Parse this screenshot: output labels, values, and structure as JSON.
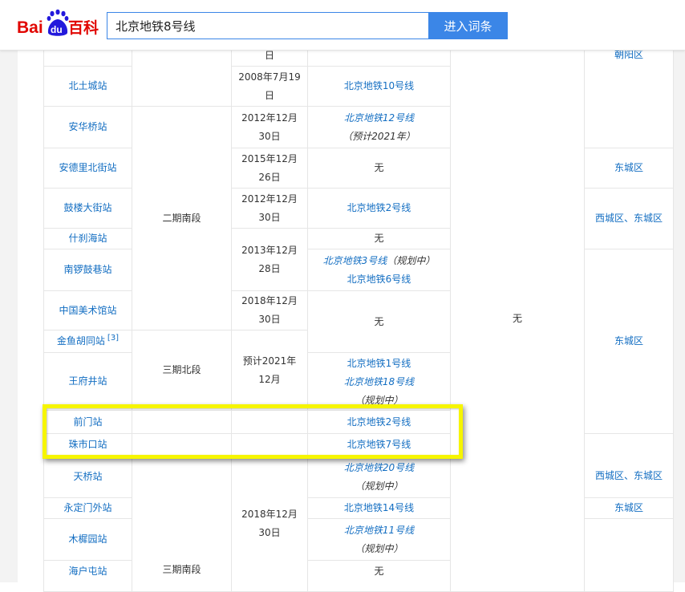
{
  "header": {
    "logo": {
      "bai": "Bai",
      "du": "du",
      "baike": "百科"
    },
    "search_value": "北京地铁8号线",
    "button_label": "进入词条"
  },
  "table": {
    "rows": [
      {
        "station": "",
        "date": "日",
        "transfer": "",
        "district": "朝阳区"
      },
      {
        "station": "北土城站",
        "date": "2008年7月19日",
        "transfer": "北京地铁10号线"
      },
      {
        "station": "安华桥站",
        "date": "2012年12月30日",
        "transfer": "北京地铁12号线",
        "transfer_note": "（预计2021年）"
      },
      {
        "station": "安德里北街站",
        "date": "2015年12月26日",
        "transfer": "无",
        "district": "东城区"
      },
      {
        "station": "鼓楼大街站",
        "date": "2012年12月30日",
        "transfer": "北京地铁2号线",
        "district": "西城区、东城区"
      },
      {
        "station": "什刹海站",
        "date": "2013年12月28日",
        "transfer": "无"
      },
      {
        "station": "南锣鼓巷站",
        "transfer": "北京地铁3号线",
        "transfer_note": "（规划中）",
        "transfer2": "北京地铁6号线"
      },
      {
        "station": "中国美术馆站",
        "date": "2018年12月30日",
        "transfer": "无"
      },
      {
        "station": "金鱼胡同站",
        "ref": "[3]",
        "date": "预计2021年12月",
        "district": "东城区"
      },
      {
        "station": "王府井站",
        "transfer": "北京地铁1号线",
        "transfer2": "北京地铁18号线",
        "transfer_note": "（规划中）"
      },
      {
        "station": "前门站",
        "transfer": "北京地铁2号线"
      },
      {
        "station": "珠市口站",
        "transfer": "北京地铁7号线"
      },
      {
        "station": "天桥站",
        "transfer": "北京地铁20号线",
        "transfer_note": "（规划中）",
        "district": "西城区、东城区"
      },
      {
        "station": "永定门外站",
        "date": "2018年12月30日",
        "transfer": "北京地铁14号线",
        "district": "东城区"
      },
      {
        "station": "木樨园站",
        "transfer": "北京地铁11号线",
        "transfer_note": "（规划中）"
      },
      {
        "station": "海户屯站",
        "transfer": "无"
      }
    ],
    "sections": {
      "phase2_south": "二期南段",
      "phase3_north": "三期北段",
      "phase3_south": "三期南段"
    },
    "opening_col": "无"
  },
  "colors": {
    "link": "#136ec2",
    "highlight": "#f6f500",
    "button": "#3b86e7",
    "logo_red": "#e10601",
    "logo_blue": "#2319dc"
  }
}
